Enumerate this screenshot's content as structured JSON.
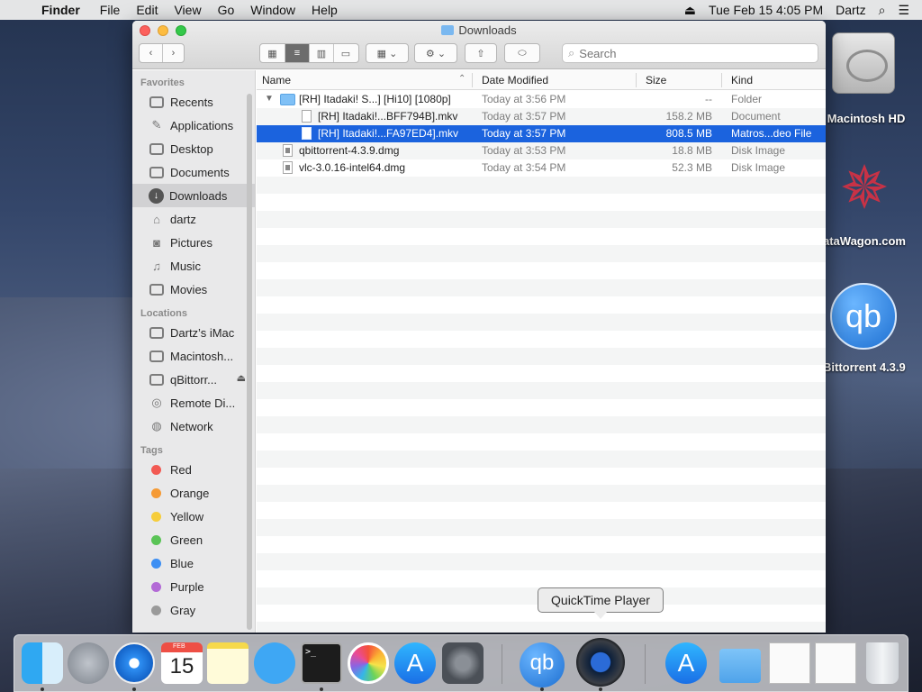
{
  "menubar": {
    "app": "Finder",
    "menus": [
      "File",
      "Edit",
      "View",
      "Go",
      "Window",
      "Help"
    ],
    "datetime": "Tue Feb 15  4:05 PM",
    "user": "Dartz"
  },
  "window": {
    "title": "Downloads",
    "search_placeholder": "Search"
  },
  "sidebar": {
    "favorites_heading": "Favorites",
    "favorites": [
      {
        "label": "Recents",
        "icon": "recents-icon"
      },
      {
        "label": "Applications",
        "icon": "applications-icon"
      },
      {
        "label": "Desktop",
        "icon": "desktop-icon"
      },
      {
        "label": "Documents",
        "icon": "documents-icon"
      },
      {
        "label": "Downloads",
        "icon": "downloads-icon"
      },
      {
        "label": "dartz",
        "icon": "home-icon"
      },
      {
        "label": "Pictures",
        "icon": "pictures-icon"
      },
      {
        "label": "Music",
        "icon": "music-icon"
      },
      {
        "label": "Movies",
        "icon": "movies-icon"
      }
    ],
    "locations_heading": "Locations",
    "locations": [
      {
        "label": "Dartz’s iMac",
        "icon": "imac-icon"
      },
      {
        "label": "Macintosh...",
        "icon": "hard-drive-icon"
      },
      {
        "label": "qBittorr...",
        "icon": "disk-image-icon"
      },
      {
        "label": "Remote Di...",
        "icon": "remote-disc-icon"
      },
      {
        "label": "Network",
        "icon": "network-icon"
      }
    ],
    "tags_heading": "Tags",
    "tags": [
      {
        "label": "Red",
        "color": "#f25a53"
      },
      {
        "label": "Orange",
        "color": "#f59a35"
      },
      {
        "label": "Yellow",
        "color": "#f6cd3b"
      },
      {
        "label": "Green",
        "color": "#5ac456"
      },
      {
        "label": "Blue",
        "color": "#3d8ff3"
      },
      {
        "label": "Purple",
        "color": "#b36ad6"
      },
      {
        "label": "Gray",
        "color": "#9a9a9a"
      }
    ]
  },
  "columns": {
    "name": "Name",
    "date": "Date Modified",
    "size": "Size",
    "kind": "Kind"
  },
  "files": [
    {
      "name": "[RH] Itadaki! S...] [Hi10] [1080p]",
      "date": "Today at 3:56 PM",
      "size": "--",
      "kind": "Folder"
    },
    {
      "name": "[RH] Itadaki!...BFF794B].mkv",
      "date": "Today at 3:57 PM",
      "size": "158.2 MB",
      "kind": "Document"
    },
    {
      "name": "[RH] Itadaki!...FA97ED4].mkv",
      "date": "Today at 3:57 PM",
      "size": "808.5 MB",
      "kind": "Matros...deo File"
    },
    {
      "name": "qbittorrent-4.3.9.dmg",
      "date": "Today at 3:53 PM",
      "size": "18.8 MB",
      "kind": "Disk Image"
    },
    {
      "name": "vlc-3.0.16-intel64.dmg",
      "date": "Today at 3:54 PM",
      "size": "52.3 MB",
      "kind": "Disk Image"
    }
  ],
  "desktop": {
    "icons": [
      "Macintosh HD",
      "ataWagon.com",
      "Bittorrent 4.3.9"
    ]
  },
  "dock": {
    "tooltip": "QuickTime Player",
    "calendar_month": "FEB",
    "calendar_day": "15",
    "qb_label": "qb"
  }
}
